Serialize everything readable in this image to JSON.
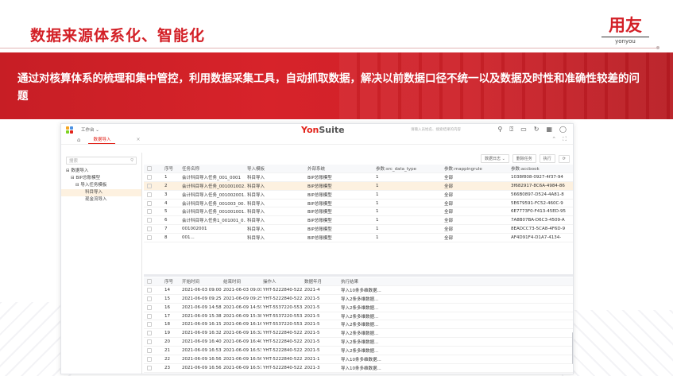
{
  "slide": {
    "title": "数据来源体系化、智能化",
    "logo_main": "用友",
    "logo_sub": "yonyou",
    "banner_text": "通过对核算体系的梳理和集中管控，利用数据采集工具，自动抓取数据，解决以前数据口径不统一以及数据及时性和准确性较差的问题"
  },
  "app": {
    "brand_a": "Yon",
    "brand_b": "Suite",
    "workbench": "工作台 ⌄",
    "search_placeholder": "请输入员姓名、搜索结果的内容",
    "active_tab": "数据导入",
    "left_search_placeholder": "搜索",
    "tree": [
      {
        "label": "⊟ 数据导入",
        "indent": 6,
        "selected": false
      },
      {
        "label": "⊟ BIP总账模型",
        "indent": 12,
        "selected": false
      },
      {
        "label": "⊟ 导入任务模板",
        "indent": 18,
        "selected": false
      },
      {
        "label": "科目导入",
        "indent": 30,
        "selected": true
      },
      {
        "label": "现金流导入",
        "indent": 30,
        "selected": false
      }
    ],
    "toolbar": [
      "数据日志 ⌄",
      "删除任务",
      "执行",
      "⟳"
    ],
    "upper_headers": [
      "序号",
      "任务名称",
      "导入模板",
      "外部系统",
      "参数:src_data_type",
      "参数:mappingrule",
      "参数:accbook"
    ],
    "upper_rows": [
      [
        "1",
        "会计科目导入任务_001_0001",
        "科目导入",
        "BIP总账模型",
        "1",
        "全部",
        "1038f808-0927-4f37-94"
      ],
      [
        "2",
        "会计科目导入任务_001001002...",
        "科目导入",
        "BIP总账模型",
        "1",
        "全部",
        "3f682917-8C6A-4984-86"
      ],
      [
        "3",
        "会计科目导入任务_001002001...",
        "科目导入",
        "BIP总账模型",
        "1",
        "全部",
        "566B0897-D524-4A81-8"
      ],
      [
        "4",
        "会计科目导入任务_001003_00...",
        "科目导入",
        "BIP总账模型",
        "1",
        "全部",
        "5E679591-FC52-460C-9"
      ],
      [
        "5",
        "会计科目导入任务_001001001...",
        "科目导入",
        "BIP总账模型",
        "1",
        "全部",
        "6E7773F0-F413-45ED-95"
      ],
      [
        "6",
        "会计科目导入任务1_001001_0...",
        "科目导入",
        "BIP总账模型",
        "1",
        "全部",
        "7A8B07BA-D6C3-4509-A"
      ],
      [
        "7",
        "001002001",
        "科目导入",
        "BIP总账模型",
        "1",
        "全部",
        "8EADCC73-5CA8-4F6D-9"
      ],
      [
        "8",
        "001...",
        "科目导入",
        "BIP总账模型",
        "1",
        "全部",
        "AF4D91F4-D1A7-4134-"
      ]
    ],
    "lower_headers": [
      "序号",
      "开始时间",
      "结束时间",
      "操作人",
      "数据年月",
      "执行结果"
    ],
    "lower_rows": [
      [
        "14",
        "2021-06-03 09:00...",
        "2021-06-03 09:01...",
        "YHT-5222840-522...",
        "2021-4",
        "导入10条多维数据..."
      ],
      [
        "15",
        "2021-06-09 09:25...",
        "2021-06-09 09:25...",
        "YHT-5222840-522...",
        "2021-5",
        "导入2条多维数据..."
      ],
      [
        "16",
        "2021-06-09 14:58...",
        "2021-06-09 14:59...",
        "YHT-5537220-553...",
        "2021-5",
        "导入2条多维数据..."
      ],
      [
        "17",
        "2021-06-09 15:38...",
        "2021-06-09 15:38...",
        "YHT-5537220-553...",
        "2021-5",
        "导入2条多维数据..."
      ],
      [
        "18",
        "2021-06-09 16:15...",
        "2021-06-09 16:16...",
        "YHT-5537220-553...",
        "2021-5",
        "导入2条多维数据..."
      ],
      [
        "19",
        "2021-06-09 16:32...",
        "2021-06-09 16:32...",
        "YHT-5222840-522...",
        "2021-5",
        "导入2条多维数据..."
      ],
      [
        "20",
        "2021-06-09 16:40...",
        "2021-06-09 16:40...",
        "YHT-5222840-522...",
        "2021-5",
        "导入2条多维数据..."
      ],
      [
        "21",
        "2021-06-09 16:53...",
        "2021-06-09 16:53...",
        "YHT-5222840-522...",
        "2021-5",
        "导入2条多维数据..."
      ],
      [
        "22",
        "2021-06-09 16:56...",
        "2021-06-09 16:56...",
        "YHT-5222840-522...",
        "2021-1",
        "导入10条多维数据..."
      ],
      [
        "23",
        "2021-06-09 16:56...",
        "2021-06-09 16:57...",
        "YHT-5222840-522...",
        "2021-3",
        "导入10条多维数据..."
      ]
    ],
    "highlight_row": 1,
    "colors": {
      "brand_red": "#d31f26",
      "selection": "#fdf1e0"
    }
  }
}
